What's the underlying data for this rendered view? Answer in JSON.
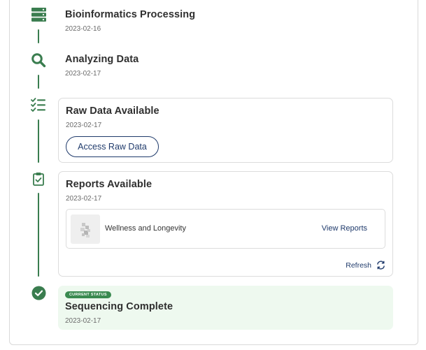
{
  "timeline": {
    "steps": [
      {
        "title": "Bioinformatics Processing",
        "date": "2023-02-16",
        "icon": "server-icon"
      },
      {
        "title": "Analyzing Data",
        "date": "2023-02-17",
        "icon": "search-icon"
      },
      {
        "title": "Raw Data Available",
        "date": "2023-02-17",
        "icon": "checklist-icon",
        "button_label": "Access Raw Data"
      },
      {
        "title": "Reports Available",
        "date": "2023-02-17",
        "icon": "clipboard-check-icon",
        "report": {
          "name": "Wellness and Longevity",
          "link_label": "View Reports"
        },
        "refresh_label": "Refresh"
      },
      {
        "badge": "CURRENT STATUS",
        "title": "Sequencing Complete",
        "date": "2023-02-17",
        "icon": "check-circle-icon"
      }
    ]
  },
  "colors": {
    "accent_green": "#3a7d4f",
    "link_blue": "#1f3a6b",
    "current_bg": "#eef9ef"
  }
}
